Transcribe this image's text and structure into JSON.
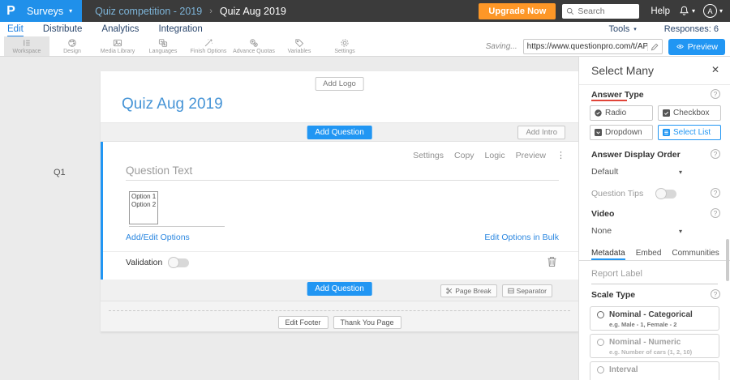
{
  "icons": {
    "caret_down": "▾",
    "dots_vertical": "⋮",
    "close": "✕",
    "breadcrumb_separator": "›",
    "help": "?"
  },
  "colors": {
    "accent_blue": "#2196f3",
    "brand_blue": "#2090ea",
    "upgrade_orange": "#fd9727",
    "topbar_dark": "#3b3b3b",
    "nav_navy": "#29456b",
    "answer_type_underline_red": "#e04438"
  },
  "topbar": {
    "logo_letter": "P",
    "product_menu": "Surveys",
    "breadcrumb": {
      "parent": "Quiz competition - 2019",
      "current": "Quiz Aug 2019"
    },
    "upgrade_button": "Upgrade Now",
    "search_placeholder": "Search",
    "help_label": "Help",
    "avatar_letter": "A"
  },
  "nav": {
    "tabs": [
      {
        "label": "Edit",
        "active": true
      },
      {
        "label": "Distribute",
        "active": false
      },
      {
        "label": "Analytics",
        "active": false
      },
      {
        "label": "Integration",
        "active": false
      }
    ],
    "tools_label": "Tools",
    "responses_label": "Responses: 6"
  },
  "toolbar": {
    "items": [
      {
        "label": "Workspace",
        "active": true
      },
      {
        "label": "Design",
        "active": false
      },
      {
        "label": "Media Library",
        "active": false
      },
      {
        "label": "Languages",
        "active": false
      },
      {
        "label": "Finish Options",
        "active": false
      },
      {
        "label": "Advance Quotas",
        "active": false
      },
      {
        "label": "Variables",
        "active": false
      },
      {
        "label": "Settings",
        "active": false
      }
    ],
    "saving_label": "Saving...",
    "share_url": "https://www.questionpro.com/t/APNrFZeyie",
    "preview_label": "Preview"
  },
  "canvas": {
    "add_logo_label": "Add Logo",
    "survey_title": "Quiz Aug 2019",
    "add_question_label": "Add Question",
    "add_intro_label": "Add Intro",
    "question": {
      "number": "Q1",
      "menu": [
        "Settings",
        "Copy",
        "Logic",
        "Preview"
      ],
      "text_placeholder": "Question Text",
      "options": [
        "Option 1",
        "Option 2"
      ],
      "add_edit_options_label": "Add/Edit Options",
      "edit_bulk_label": "Edit Options in Bulk",
      "validation_label": "Validation",
      "validation_on": false
    },
    "page_break_label": "Page Break",
    "separator_label": "Separator",
    "edit_footer_label": "Edit Footer",
    "thank_you_label": "Thank You Page"
  },
  "panel": {
    "title": "Select Many",
    "answer_type_label": "Answer Type",
    "answer_types": [
      {
        "label": "Radio",
        "selected": false
      },
      {
        "label": "Checkbox",
        "selected": false
      },
      {
        "label": "Dropdown",
        "selected": false
      },
      {
        "label": "Select List",
        "selected": true
      }
    ],
    "answer_display_order_label": "Answer Display Order",
    "answer_display_order_value": "Default",
    "question_tips_label": "Question Tips",
    "question_tips_on": false,
    "video_label": "Video",
    "video_value": "None",
    "tabs": [
      {
        "label": "Metadata",
        "active": true
      },
      {
        "label": "Embed",
        "active": false
      },
      {
        "label": "Communities",
        "active": false
      }
    ],
    "report_label_placeholder": "Report Label",
    "scale_type_label": "Scale Type",
    "scale_types": [
      {
        "name": "Nominal - Categorical",
        "example": "e.g. Male - 1, Female - 2",
        "enabled": true
      },
      {
        "name": "Nominal - Numeric",
        "example": "e.g. Number of cars (1, 2, 10)",
        "enabled": false
      },
      {
        "name": "Interval",
        "example": "",
        "enabled": false
      }
    ]
  }
}
